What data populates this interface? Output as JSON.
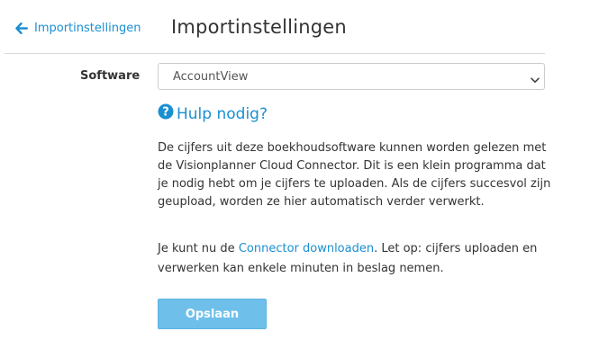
{
  "nav": {
    "back_label": "Importinstellingen",
    "back_icon": "arrow-left-icon"
  },
  "header": {
    "title": "Importinstellingen"
  },
  "form": {
    "software_label": "Software",
    "software_value": "AccountView",
    "dropdown_icon": "chevron-down-icon"
  },
  "help": {
    "label": "Hulp nodig?",
    "icon": "question-circle-icon"
  },
  "info": {
    "paragraph1": "De cijfers uit deze boekhoudsoftware kunnen worden gelezen met de Visionplanner Cloud Connector. Dit is een klein programma dat je nodig hebt om je cijfers te uploaden. Als de cijfers succesvol zijn geupload, worden ze hier automatisch verder verwerkt.",
    "paragraph2_prefix": "Je kunt nu de",
    "paragraph2_link": "Connector downloaden",
    "paragraph2_suffix": ". Let op: cijfers uploaden en verwerken kan enkele minuten in beslag nemen."
  },
  "actions": {
    "save_label": "Opslaan"
  },
  "colors": {
    "accent": "#1a8fd1",
    "button": "#6ec0ea",
    "text": "#333333",
    "divider": "#d9d9d9"
  }
}
